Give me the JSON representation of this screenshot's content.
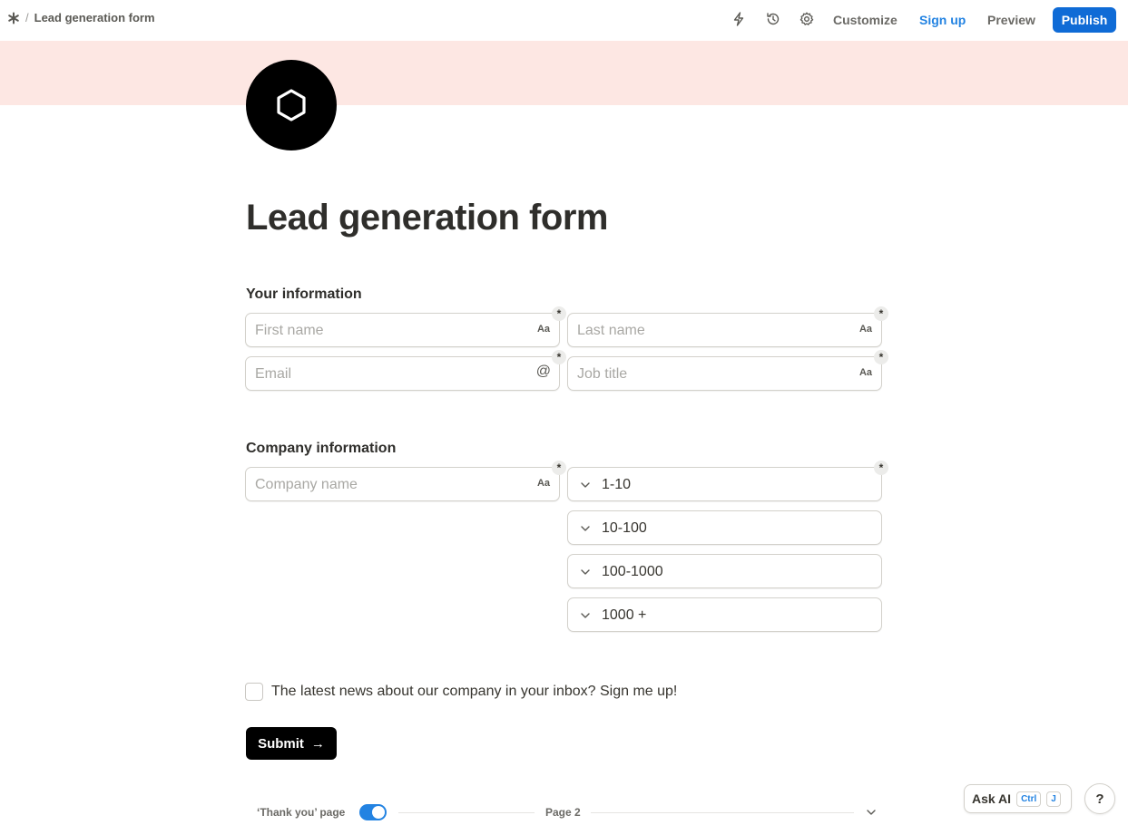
{
  "topbar": {
    "breadcrumb_sep": "/",
    "page_name": "Lead generation form",
    "customize": "Customize",
    "sign_up": "Sign up",
    "preview": "Preview",
    "publish": "Publish"
  },
  "form": {
    "title": "Lead generation form",
    "sections": {
      "your_info": "Your information",
      "company_info": "Company information"
    },
    "fields": {
      "first_name": {
        "placeholder": "First name",
        "type_icon": "Aa",
        "required": "*"
      },
      "last_name": {
        "placeholder": "Last name",
        "type_icon": "Aa",
        "required": "*"
      },
      "email": {
        "placeholder": "Email",
        "type_icon": "@",
        "required": "*"
      },
      "job_title": {
        "placeholder": "Job title",
        "type_icon": "Aa",
        "required": "*"
      },
      "company_name": {
        "placeholder": "Company name",
        "type_icon": "Aa",
        "required": "*"
      },
      "company_size_required": "*"
    },
    "size_options": [
      "1-10",
      "10-100",
      "100-1000",
      "1000 +"
    ],
    "newsletter_label": "The latest news about our company in your inbox? Sign me up!",
    "submit_label": "Submit",
    "submit_arrow": "→"
  },
  "footer": {
    "thank_you_label": "‘Thank you’ page",
    "thank_you_enabled": true,
    "page2_label": "Page 2"
  },
  "assist": {
    "ask_ai": "Ask AI",
    "shortcut_ctrl": "Ctrl",
    "shortcut_key": "J",
    "help": "?"
  },
  "colors": {
    "cover": "#fde7e3",
    "accent": "#2383e2",
    "publish_bg": "#0f6bd6"
  }
}
